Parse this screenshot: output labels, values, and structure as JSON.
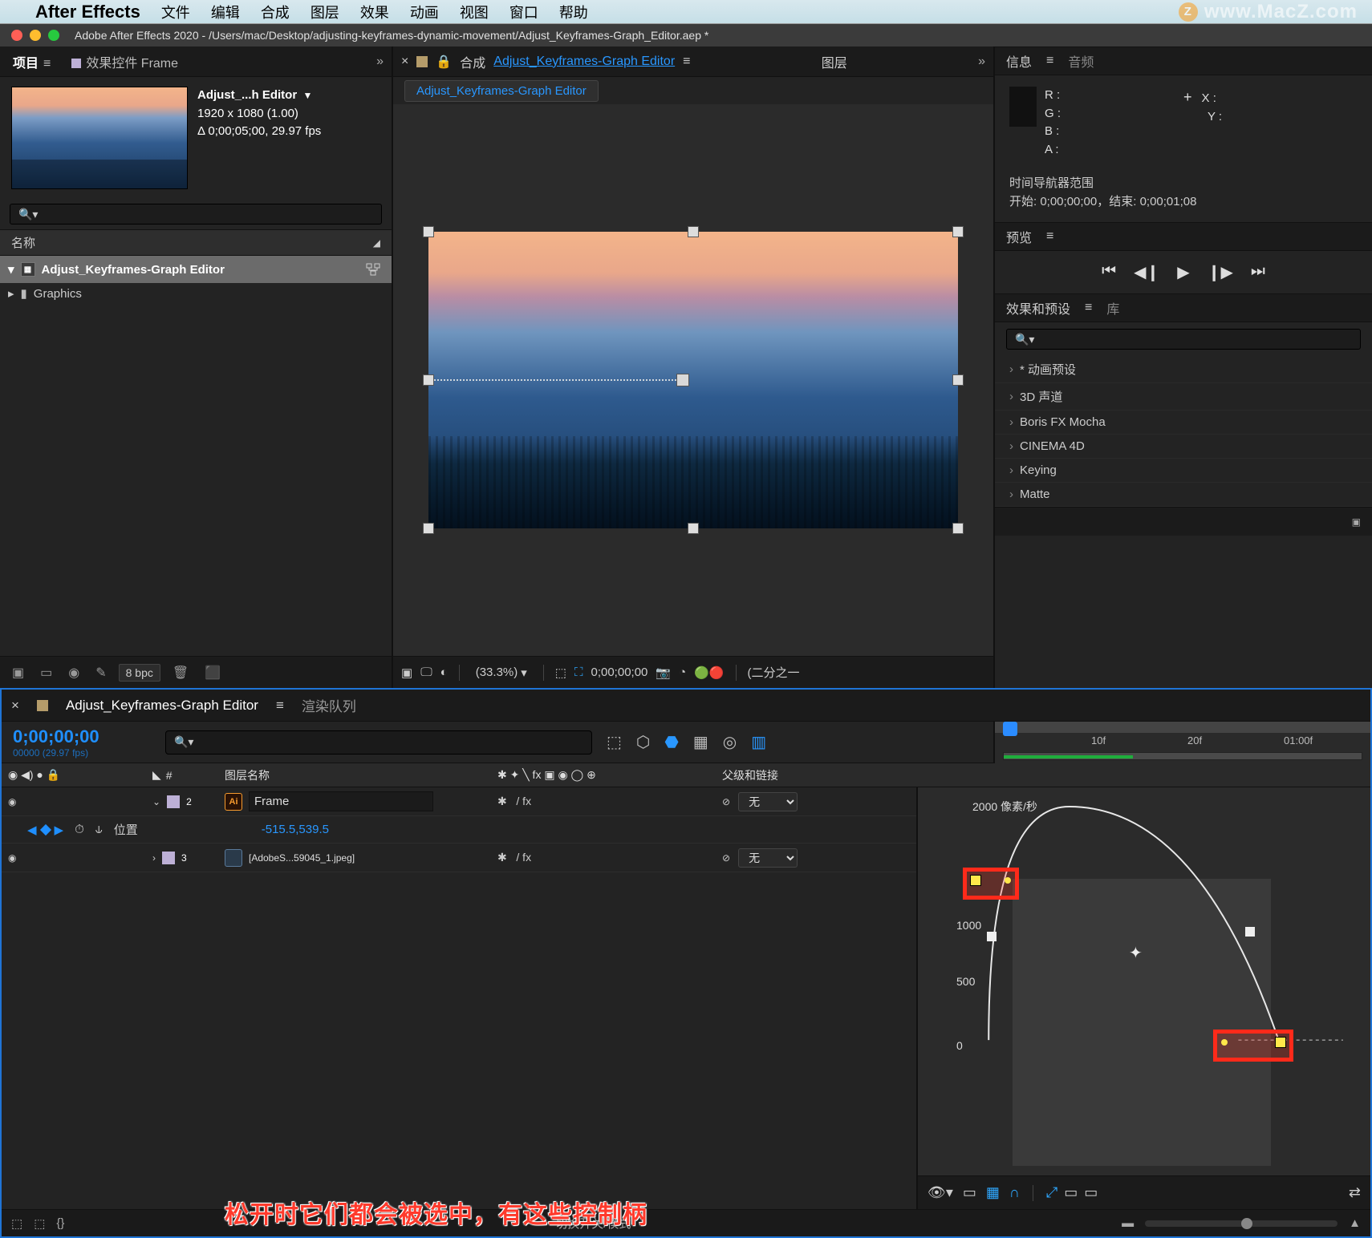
{
  "macos_menu": {
    "app": "After Effects",
    "items": [
      "文件",
      "编辑",
      "合成",
      "图层",
      "效果",
      "动画",
      "视图",
      "窗口",
      "帮助"
    ],
    "watermark": "www.MacZ.com"
  },
  "window": {
    "title": "Adobe After Effects 2020 - /Users/mac/Desktop/adjusting-keyframes-dynamic-movement/Adjust_Keyframes-Graph_Editor.aep *"
  },
  "project": {
    "tabs": {
      "project": "项目",
      "fx": "效果控件 Frame"
    },
    "comp": {
      "name": "Adjust_...h Editor",
      "dims": "1920 x 1080 (1.00)",
      "dur": "Δ 0;00;05;00, 29.97 fps"
    },
    "search_placeholder": "",
    "header": "名称",
    "items": [
      {
        "name": "Adjust_Keyframes-Graph Editor",
        "type": "comp",
        "selected": true
      },
      {
        "name": "Graphics",
        "type": "folder",
        "selected": false
      }
    ],
    "bpc": "8 bpc"
  },
  "composition": {
    "tabs": {
      "label": "合成",
      "active": "Adjust_Keyframes-Graph Editor",
      "layer": "图层"
    },
    "breadcrumb": "Adjust_Keyframes-Graph Editor",
    "footer": {
      "zoom": "(33.3%)",
      "time": "0;00;00;00",
      "view": "(二分之一"
    }
  },
  "info": {
    "title": "信息",
    "audio": "音频",
    "rgba": {
      "R": "R :",
      "G": "G :",
      "B": "B :",
      "A": "A :"
    },
    "xy": {
      "X": "X :",
      "Y": "Y :"
    },
    "nav": {
      "title": "时间导航器范围",
      "range": "开始: 0;00;00;00，结束: 0;00;01;08"
    }
  },
  "preview": {
    "title": "预览"
  },
  "effects": {
    "title": "效果和预设",
    "lib": "库",
    "search_placeholder": "",
    "items": [
      "* 动画预设",
      "3D 声道",
      "Boris FX Mocha",
      "CINEMA 4D",
      "Keying",
      "Matte"
    ]
  },
  "timeline": {
    "tabs": {
      "active": "Adjust_Keyframes-Graph Editor",
      "render": "渲染队列"
    },
    "timecode": "0;00;00;00",
    "frames": "00000 (29.97 fps)",
    "search_placeholder": "",
    "ruler": [
      "10f",
      "20f",
      "01:00f"
    ],
    "columns": {
      "num": "#",
      "name": "图层名称",
      "parent": "父级和链接"
    },
    "layers": [
      {
        "idx": "2",
        "icon": "ai",
        "name": "Frame",
        "parent": "无",
        "editable": true,
        "props": [
          {
            "name": "位置",
            "value": "-515.5,539.5"
          }
        ]
      },
      {
        "idx": "3",
        "icon": "img",
        "name": "[AdobeS...59045_1.jpeg]",
        "parent": "无",
        "editable": false
      }
    ],
    "graph": {
      "ylabel": "2000 像素/秒",
      "ticks": [
        "1000",
        "500",
        "0"
      ]
    },
    "footer": {
      "mode": "切换开关/模式"
    }
  },
  "annotation": "松开时它们都会被选中，有这些控制柄"
}
